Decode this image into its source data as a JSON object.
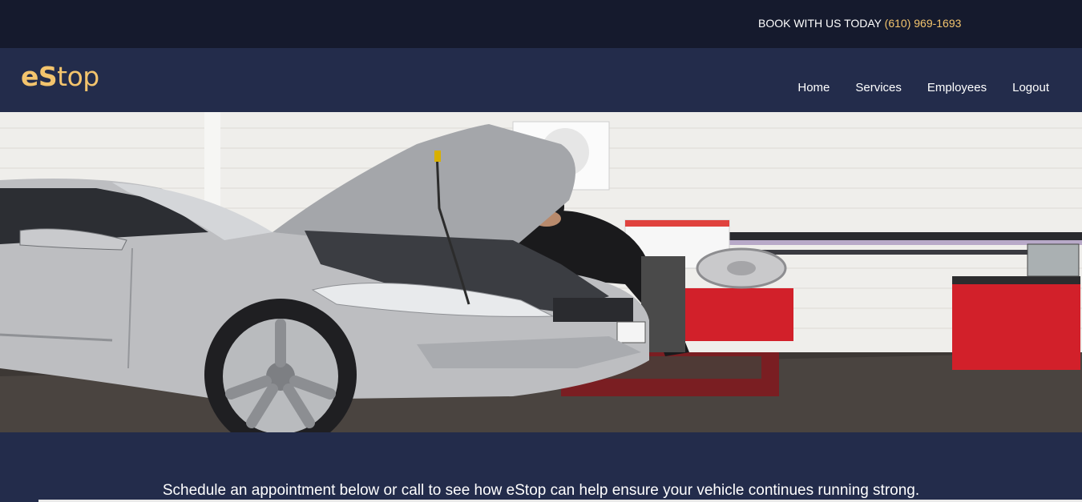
{
  "topbar": {
    "book_text": "BOOK WITH US TODAY",
    "phone": "(610) 969-1693"
  },
  "brand": {
    "logo_bold": "eS",
    "logo_rest": "top"
  },
  "nav": {
    "items": [
      {
        "label": "Home"
      },
      {
        "label": "Services"
      },
      {
        "label": "Employees"
      },
      {
        "label": "Logout"
      }
    ]
  },
  "hero": {
    "image_icon": "mechanic-car-photo"
  },
  "main": {
    "tagline": "Schedule an appointment below or call to see how eStop can help ensure your vehicle continues running strong."
  },
  "colors": {
    "topbar_bg": "#151a2d",
    "navbar_bg": "#232c4b",
    "accent": "#f3c46d",
    "text": "#ffffff"
  }
}
